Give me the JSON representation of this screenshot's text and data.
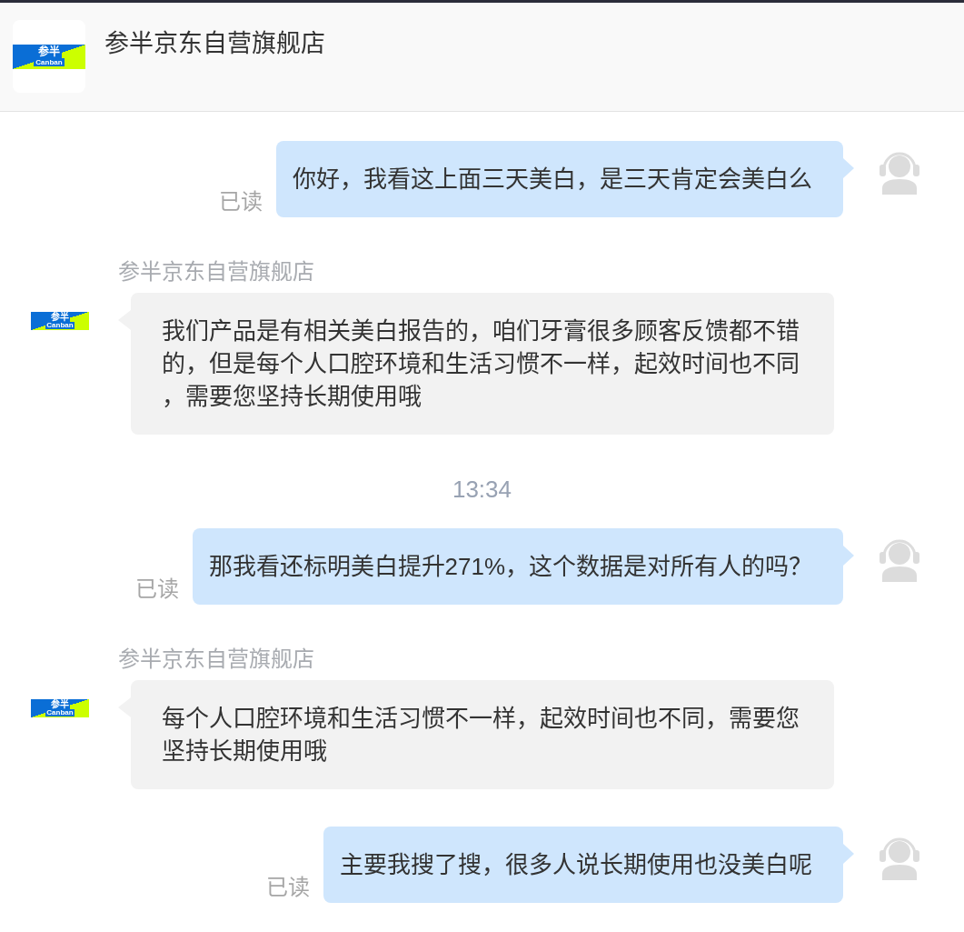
{
  "header": {
    "logo": {
      "mark": "参半",
      "wordmark": "Canban"
    },
    "title": "参半京东自营旗舰店"
  },
  "messages": [
    {
      "kind": "outgoing",
      "text": "你好，我看这上面三天美白，是三天肯定会美白么",
      "status": "已读"
    },
    {
      "kind": "incoming",
      "sender": "参半京东自营旗舰店",
      "avatar": {
        "mark": "参半",
        "wordmark": "Canban"
      },
      "text": "我们产品是有相关美白报告的，咱们牙膏很多顾客反馈都不错的，但是每个人口腔环境和生活习惯不一样，起效时间也不同，需要您坚持长期使用哦"
    },
    {
      "kind": "time",
      "text": "13:34"
    },
    {
      "kind": "outgoing",
      "text": "那我看还标明美白提升271%，这个数据是对所有人的吗？",
      "status": "已读"
    },
    {
      "kind": "incoming",
      "sender": "参半京东自营旗舰店",
      "avatar": {
        "mark": "参半",
        "wordmark": "Canban"
      },
      "text": "每个人口腔环境和生活习惯不一样，起效时间也不同，需要您坚持长期使用哦"
    },
    {
      "kind": "outgoing",
      "text": "主要我搜了搜，很多人说长期使用也没美白呢",
      "status": "已读"
    }
  ]
}
